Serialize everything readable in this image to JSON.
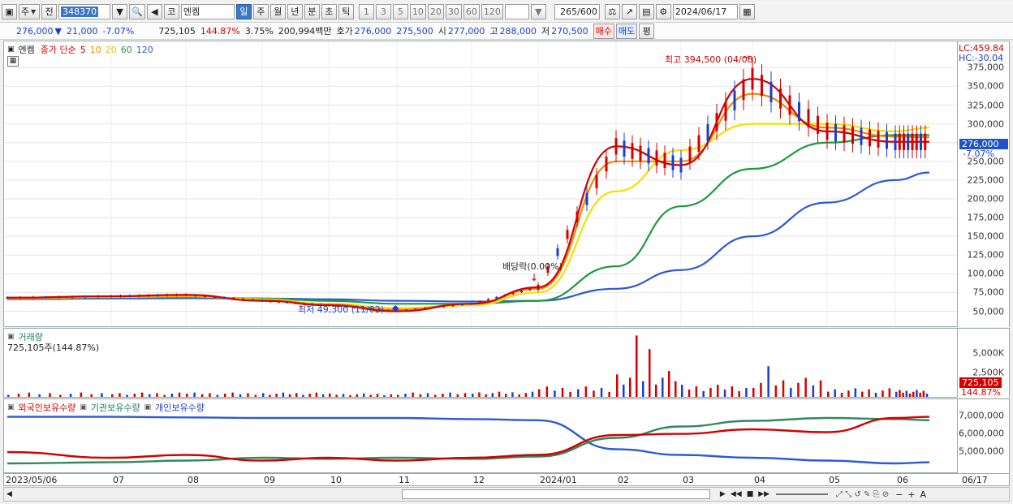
{
  "toolbar": {
    "type_label": "주",
    "prev_label": "전",
    "stock_code": "348370",
    "market_label": "코",
    "stock_name": "엔켐",
    "periods": [
      "일",
      "주",
      "월",
      "년",
      "분",
      "초",
      "틱"
    ],
    "period_selected": "일",
    "intervals": [
      "1",
      "3",
      "5",
      "10",
      "20",
      "30",
      "60",
      "120"
    ],
    "count": "265",
    "count_total": "/600",
    "date": "2024/06/17"
  },
  "quote": {
    "price": "276,000",
    "direction_icon": "down-triangle-icon",
    "change": "21,000",
    "change_pct": "-7.07%",
    "volume": "725,105",
    "volume_ratio": "144.87%",
    "turnover_pct": "3.75%",
    "trade_value": "200,994백만",
    "ask_label": "호가",
    "ask1": "276,000",
    "ask2": "275,500",
    "open_label": "시",
    "open": "277,000",
    "high_label": "고",
    "high": "288,000",
    "low_label": "저",
    "low": "270,500",
    "buy_label": "매수",
    "sell_label": "매도",
    "avg_label": "평"
  },
  "price_panel": {
    "name": "엔켐",
    "indicator": "종가 단순",
    "ma_labels": [
      "5",
      "10",
      "20",
      "60",
      "120"
    ],
    "max_annotation": "최고 394,500 (04/08)",
    "min_annotation": "최저 49,300 (11/02)",
    "dividend_annotation": "배당락(0.00%)",
    "lc_label": "LC:459.84",
    "hc_label": "HC:-30.04",
    "current_price_tag": "276,000",
    "current_change_tag": "-7.07%",
    "y_ticks": [
      "375,000",
      "350,000",
      "325,000",
      "300,000",
      "275,000",
      "250,000",
      "225,000",
      "200,000",
      "175,000",
      "150,000",
      "125,000",
      "100,000",
      "75,000",
      "50,000"
    ]
  },
  "volume_panel": {
    "name": "거래량",
    "value_label": "725,105주(144.87%)",
    "y_ticks": [
      "5,000K",
      "2,500K"
    ],
    "current_tag": "725,105",
    "current_pct_tag": "144.87%"
  },
  "holdings_panel": {
    "legends": [
      "외국인보유수량",
      "기관보유수량",
      "개인보유수량"
    ],
    "y_ticks": [
      "7,000,000",
      "6,000,000",
      "5,000,000"
    ]
  },
  "x_axis": {
    "labels": [
      "2023/05/06",
      "07",
      "08",
      "09",
      "10",
      "11",
      "12",
      "2024/01",
      "02",
      "03",
      "04",
      "05",
      "06",
      "06/17"
    ]
  },
  "colors": {
    "ma5": "#d40000",
    "ma10": "#f08a00",
    "ma20": "#f5e000",
    "ma60": "#1c9a3c",
    "ma120": "#3058d8",
    "up": "#d40000",
    "down": "#1a3fc9"
  },
  "chart_data": {
    "type": "line",
    "x": [
      "2023-05",
      "2023-07",
      "2023-08",
      "2023-09",
      "2023-10",
      "2023-11",
      "2023-12",
      "2024-01",
      "2024-02",
      "2024-03",
      "2024-04",
      "2024-05",
      "2024-06",
      "2024-06-17"
    ],
    "series": [
      {
        "name": "5",
        "values": [
          68000,
          70000,
          72000,
          64000,
          58000,
          50000,
          60000,
          82000,
          270000,
          245000,
          360000,
          290000,
          276000,
          276000
        ]
      },
      {
        "name": "10",
        "values": [
          68000,
          70000,
          71000,
          65000,
          59000,
          52000,
          60000,
          80000,
          250000,
          250000,
          340000,
          295000,
          283000,
          282000
        ]
      },
      {
        "name": "20",
        "values": [
          67000,
          69000,
          70000,
          66000,
          60000,
          54000,
          58000,
          75000,
          210000,
          265000,
          300000,
          300000,
          290000,
          295000
        ]
      },
      {
        "name": "60",
        "values": [
          68000,
          68500,
          69000,
          67000,
          64000,
          60000,
          60000,
          64000,
          110000,
          190000,
          240000,
          275000,
          285000,
          285000
        ]
      },
      {
        "name": "120",
        "values": [
          66000,
          67000,
          67500,
          67000,
          66000,
          64000,
          63000,
          64000,
          80000,
          105000,
          150000,
          195000,
          225000,
          235000
        ]
      }
    ],
    "ylim": [
      30000,
      410000
    ]
  }
}
